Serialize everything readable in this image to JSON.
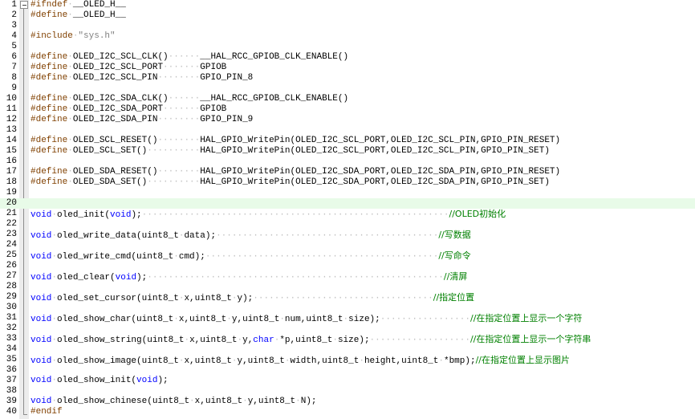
{
  "editor": {
    "current_line": "20",
    "lines": [
      {
        "num": "1",
        "tokens": [
          {
            "t": "pp",
            "s": "#ifndef"
          },
          {
            "t": "ws",
            "s": "·"
          },
          {
            "t": "plain",
            "s": "__OLED_H__"
          }
        ]
      },
      {
        "num": "2",
        "tokens": [
          {
            "t": "pp",
            "s": "#define"
          },
          {
            "t": "ws",
            "s": "·"
          },
          {
            "t": "plain",
            "s": "__OLED_H__"
          }
        ]
      },
      {
        "num": "3",
        "tokens": []
      },
      {
        "num": "4",
        "tokens": [
          {
            "t": "pp",
            "s": "#include"
          },
          {
            "t": "ws",
            "s": "·"
          },
          {
            "t": "st",
            "s": "\"sys.h\""
          }
        ]
      },
      {
        "num": "5",
        "tokens": []
      },
      {
        "num": "6",
        "tokens": [
          {
            "t": "pp",
            "s": "#define"
          },
          {
            "t": "ws",
            "s": "·"
          },
          {
            "t": "plain",
            "s": "OLED_I2C_SCL_CLK()"
          },
          {
            "t": "ws",
            "s": "······"
          },
          {
            "t": "plain",
            "s": "__HAL_RCC_GPIOB_CLK_ENABLE()"
          }
        ]
      },
      {
        "num": "7",
        "tokens": [
          {
            "t": "pp",
            "s": "#define"
          },
          {
            "t": "ws",
            "s": "·"
          },
          {
            "t": "plain",
            "s": "OLED_I2C_SCL_PORT"
          },
          {
            "t": "ws",
            "s": "·······"
          },
          {
            "t": "plain",
            "s": "GPIOB"
          }
        ]
      },
      {
        "num": "8",
        "tokens": [
          {
            "t": "pp",
            "s": "#define"
          },
          {
            "t": "ws",
            "s": "·"
          },
          {
            "t": "plain",
            "s": "OLED_I2C_SCL_PIN"
          },
          {
            "t": "ws",
            "s": "········"
          },
          {
            "t": "plain",
            "s": "GPIO_PIN_8"
          }
        ]
      },
      {
        "num": "9",
        "tokens": []
      },
      {
        "num": "10",
        "tokens": [
          {
            "t": "pp",
            "s": "#define"
          },
          {
            "t": "ws",
            "s": "·"
          },
          {
            "t": "plain",
            "s": "OLED_I2C_SDA_CLK()"
          },
          {
            "t": "ws",
            "s": "······"
          },
          {
            "t": "plain",
            "s": "__HAL_RCC_GPIOB_CLK_ENABLE()"
          }
        ]
      },
      {
        "num": "11",
        "tokens": [
          {
            "t": "pp",
            "s": "#define"
          },
          {
            "t": "ws",
            "s": "·"
          },
          {
            "t": "plain",
            "s": "OLED_I2C_SDA_PORT"
          },
          {
            "t": "ws",
            "s": "·······"
          },
          {
            "t": "plain",
            "s": "GPIOB"
          }
        ]
      },
      {
        "num": "12",
        "tokens": [
          {
            "t": "pp",
            "s": "#define"
          },
          {
            "t": "ws",
            "s": "·"
          },
          {
            "t": "plain",
            "s": "OLED_I2C_SDA_PIN"
          },
          {
            "t": "ws",
            "s": "········"
          },
          {
            "t": "plain",
            "s": "GPIO_PIN_9"
          }
        ]
      },
      {
        "num": "13",
        "tokens": []
      },
      {
        "num": "14",
        "tokens": [
          {
            "t": "pp",
            "s": "#define"
          },
          {
            "t": "ws",
            "s": "·"
          },
          {
            "t": "plain",
            "s": "OLED_SCL_RESET()"
          },
          {
            "t": "ws",
            "s": "········"
          },
          {
            "t": "plain",
            "s": "HAL_GPIO_WritePin(OLED_I2C_SCL_PORT,OLED_I2C_SCL_PIN,GPIO_PIN_RESET)"
          }
        ]
      },
      {
        "num": "15",
        "tokens": [
          {
            "t": "pp",
            "s": "#define"
          },
          {
            "t": "ws",
            "s": "·"
          },
          {
            "t": "plain",
            "s": "OLED_SCL_SET()"
          },
          {
            "t": "ws",
            "s": "··········"
          },
          {
            "t": "plain",
            "s": "HAL_GPIO_WritePin(OLED_I2C_SCL_PORT,OLED_I2C_SCL_PIN,GPIO_PIN_SET)"
          }
        ]
      },
      {
        "num": "16",
        "tokens": []
      },
      {
        "num": "17",
        "tokens": [
          {
            "t": "pp",
            "s": "#define"
          },
          {
            "t": "ws",
            "s": "·"
          },
          {
            "t": "plain",
            "s": "OLED_SDA_RESET()"
          },
          {
            "t": "ws",
            "s": "········"
          },
          {
            "t": "plain",
            "s": "HAL_GPIO_WritePin(OLED_I2C_SDA_PORT,OLED_I2C_SDA_PIN,GPIO_PIN_RESET)"
          }
        ]
      },
      {
        "num": "18",
        "tokens": [
          {
            "t": "pp",
            "s": "#define"
          },
          {
            "t": "ws",
            "s": "·"
          },
          {
            "t": "plain",
            "s": "OLED_SDA_SET()"
          },
          {
            "t": "ws",
            "s": "··········"
          },
          {
            "t": "plain",
            "s": "HAL_GPIO_WritePin(OLED_I2C_SDA_PORT,OLED_I2C_SDA_PIN,GPIO_PIN_SET)"
          }
        ]
      },
      {
        "num": "19",
        "tokens": []
      },
      {
        "num": "20",
        "tokens": []
      },
      {
        "num": "21",
        "tokens": [
          {
            "t": "ty",
            "s": "void"
          },
          {
            "t": "ws",
            "s": "·"
          },
          {
            "t": "plain",
            "s": "oled_init("
          },
          {
            "t": "ty",
            "s": "void"
          },
          {
            "t": "plain",
            "s": ");"
          },
          {
            "t": "ws",
            "s": "··························································"
          },
          {
            "t": "cm",
            "s": "//OLED初始化"
          }
        ]
      },
      {
        "num": "22",
        "tokens": []
      },
      {
        "num": "23",
        "tokens": [
          {
            "t": "ty",
            "s": "void"
          },
          {
            "t": "ws",
            "s": "·"
          },
          {
            "t": "plain",
            "s": "oled_write_data(uint8_t"
          },
          {
            "t": "ws",
            "s": "·"
          },
          {
            "t": "plain",
            "s": "data);"
          },
          {
            "t": "ws",
            "s": "··········································"
          },
          {
            "t": "cm",
            "s": "//写数据"
          }
        ]
      },
      {
        "num": "24",
        "tokens": []
      },
      {
        "num": "25",
        "tokens": [
          {
            "t": "ty",
            "s": "void"
          },
          {
            "t": "ws",
            "s": "·"
          },
          {
            "t": "plain",
            "s": "oled_write_cmd(uint8_t"
          },
          {
            "t": "ws",
            "s": "·"
          },
          {
            "t": "plain",
            "s": "cmd);"
          },
          {
            "t": "ws",
            "s": "············································"
          },
          {
            "t": "cm",
            "s": "//写命令"
          }
        ]
      },
      {
        "num": "26",
        "tokens": []
      },
      {
        "num": "27",
        "tokens": [
          {
            "t": "ty",
            "s": "void"
          },
          {
            "t": "ws",
            "s": "·"
          },
          {
            "t": "plain",
            "s": "oled_clear("
          },
          {
            "t": "ty",
            "s": "void"
          },
          {
            "t": "plain",
            "s": ");"
          },
          {
            "t": "ws",
            "s": "························································"
          },
          {
            "t": "cm",
            "s": "//清屏"
          }
        ]
      },
      {
        "num": "28",
        "tokens": []
      },
      {
        "num": "29",
        "tokens": [
          {
            "t": "ty",
            "s": "void"
          },
          {
            "t": "ws",
            "s": "·"
          },
          {
            "t": "plain",
            "s": "oled_set_cursor(uint8_t"
          },
          {
            "t": "ws",
            "s": "·"
          },
          {
            "t": "plain",
            "s": "x,uint8_t"
          },
          {
            "t": "ws",
            "s": "·"
          },
          {
            "t": "plain",
            "s": "y);"
          },
          {
            "t": "ws",
            "s": "··································"
          },
          {
            "t": "cm",
            "s": "//指定位置"
          }
        ]
      },
      {
        "num": "30",
        "tokens": []
      },
      {
        "num": "31",
        "tokens": [
          {
            "t": "ty",
            "s": "void"
          },
          {
            "t": "ws",
            "s": "·"
          },
          {
            "t": "plain",
            "s": "oled_show_char(uint8_t"
          },
          {
            "t": "ws",
            "s": "·"
          },
          {
            "t": "plain",
            "s": "x,uint8_t"
          },
          {
            "t": "ws",
            "s": "·"
          },
          {
            "t": "plain",
            "s": "y,uint8_t"
          },
          {
            "t": "ws",
            "s": "·"
          },
          {
            "t": "plain",
            "s": "num,uint8_t"
          },
          {
            "t": "ws",
            "s": "·"
          },
          {
            "t": "plain",
            "s": "size);"
          },
          {
            "t": "ws",
            "s": "·················"
          },
          {
            "t": "cm",
            "s": "//在指定位置上显示一个字符"
          }
        ]
      },
      {
        "num": "32",
        "tokens": []
      },
      {
        "num": "33",
        "tokens": [
          {
            "t": "ty",
            "s": "void"
          },
          {
            "t": "ws",
            "s": "·"
          },
          {
            "t": "plain",
            "s": "oled_show_string(uint8_t"
          },
          {
            "t": "ws",
            "s": "·"
          },
          {
            "t": "plain",
            "s": "x,uint8_t"
          },
          {
            "t": "ws",
            "s": "·"
          },
          {
            "t": "plain",
            "s": "y,"
          },
          {
            "t": "ty",
            "s": "char"
          },
          {
            "t": "ws",
            "s": "·"
          },
          {
            "t": "plain",
            "s": "*p,uint8_t"
          },
          {
            "t": "ws",
            "s": "·"
          },
          {
            "t": "plain",
            "s": "size);"
          },
          {
            "t": "ws",
            "s": "···················"
          },
          {
            "t": "cm",
            "s": "//在指定位置上显示一个字符串"
          }
        ]
      },
      {
        "num": "34",
        "tokens": []
      },
      {
        "num": "35",
        "tokens": [
          {
            "t": "ty",
            "s": "void"
          },
          {
            "t": "ws",
            "s": "·"
          },
          {
            "t": "plain",
            "s": "oled_show_image(uint8_t"
          },
          {
            "t": "ws",
            "s": "·"
          },
          {
            "t": "plain",
            "s": "x,uint8_t"
          },
          {
            "t": "ws",
            "s": "·"
          },
          {
            "t": "plain",
            "s": "y,uint8_t"
          },
          {
            "t": "ws",
            "s": "·"
          },
          {
            "t": "plain",
            "s": "width,uint8_t"
          },
          {
            "t": "ws",
            "s": "·"
          },
          {
            "t": "plain",
            "s": "height,uint8_t"
          },
          {
            "t": "ws",
            "s": "·"
          },
          {
            "t": "plain",
            "s": "*bmp);"
          },
          {
            "t": "cm",
            "s": "//在指定位置上显示图片"
          }
        ]
      },
      {
        "num": "36",
        "tokens": []
      },
      {
        "num": "37",
        "tokens": [
          {
            "t": "ty",
            "s": "void"
          },
          {
            "t": "ws",
            "s": "·"
          },
          {
            "t": "plain",
            "s": "oled_show_init("
          },
          {
            "t": "ty",
            "s": "void"
          },
          {
            "t": "plain",
            "s": ");"
          }
        ]
      },
      {
        "num": "38",
        "tokens": []
      },
      {
        "num": "39",
        "tokens": [
          {
            "t": "ty",
            "s": "void"
          },
          {
            "t": "ws",
            "s": "·"
          },
          {
            "t": "plain",
            "s": "oled_show_chinese(uint8_t"
          },
          {
            "t": "ws",
            "s": "·"
          },
          {
            "t": "plain",
            "s": "x,uint8_t"
          },
          {
            "t": "ws",
            "s": "·"
          },
          {
            "t": "plain",
            "s": "y,uint8_t"
          },
          {
            "t": "ws",
            "s": "·"
          },
          {
            "t": "plain",
            "s": "N);"
          }
        ]
      },
      {
        "num": "40",
        "tokens": [
          {
            "t": "pp",
            "s": "#endif"
          }
        ]
      }
    ]
  },
  "colors": {
    "preprocessor": "#804000",
    "keyword_type": "#0000ff",
    "string": "#808080",
    "comment": "#008000",
    "whitespace_marker": "#c0c0c0",
    "current_line_background": "#e8fbe8",
    "fold_margin": "#ececec"
  },
  "icons": {
    "fold_toggle": "fold-minus-box-icon"
  }
}
